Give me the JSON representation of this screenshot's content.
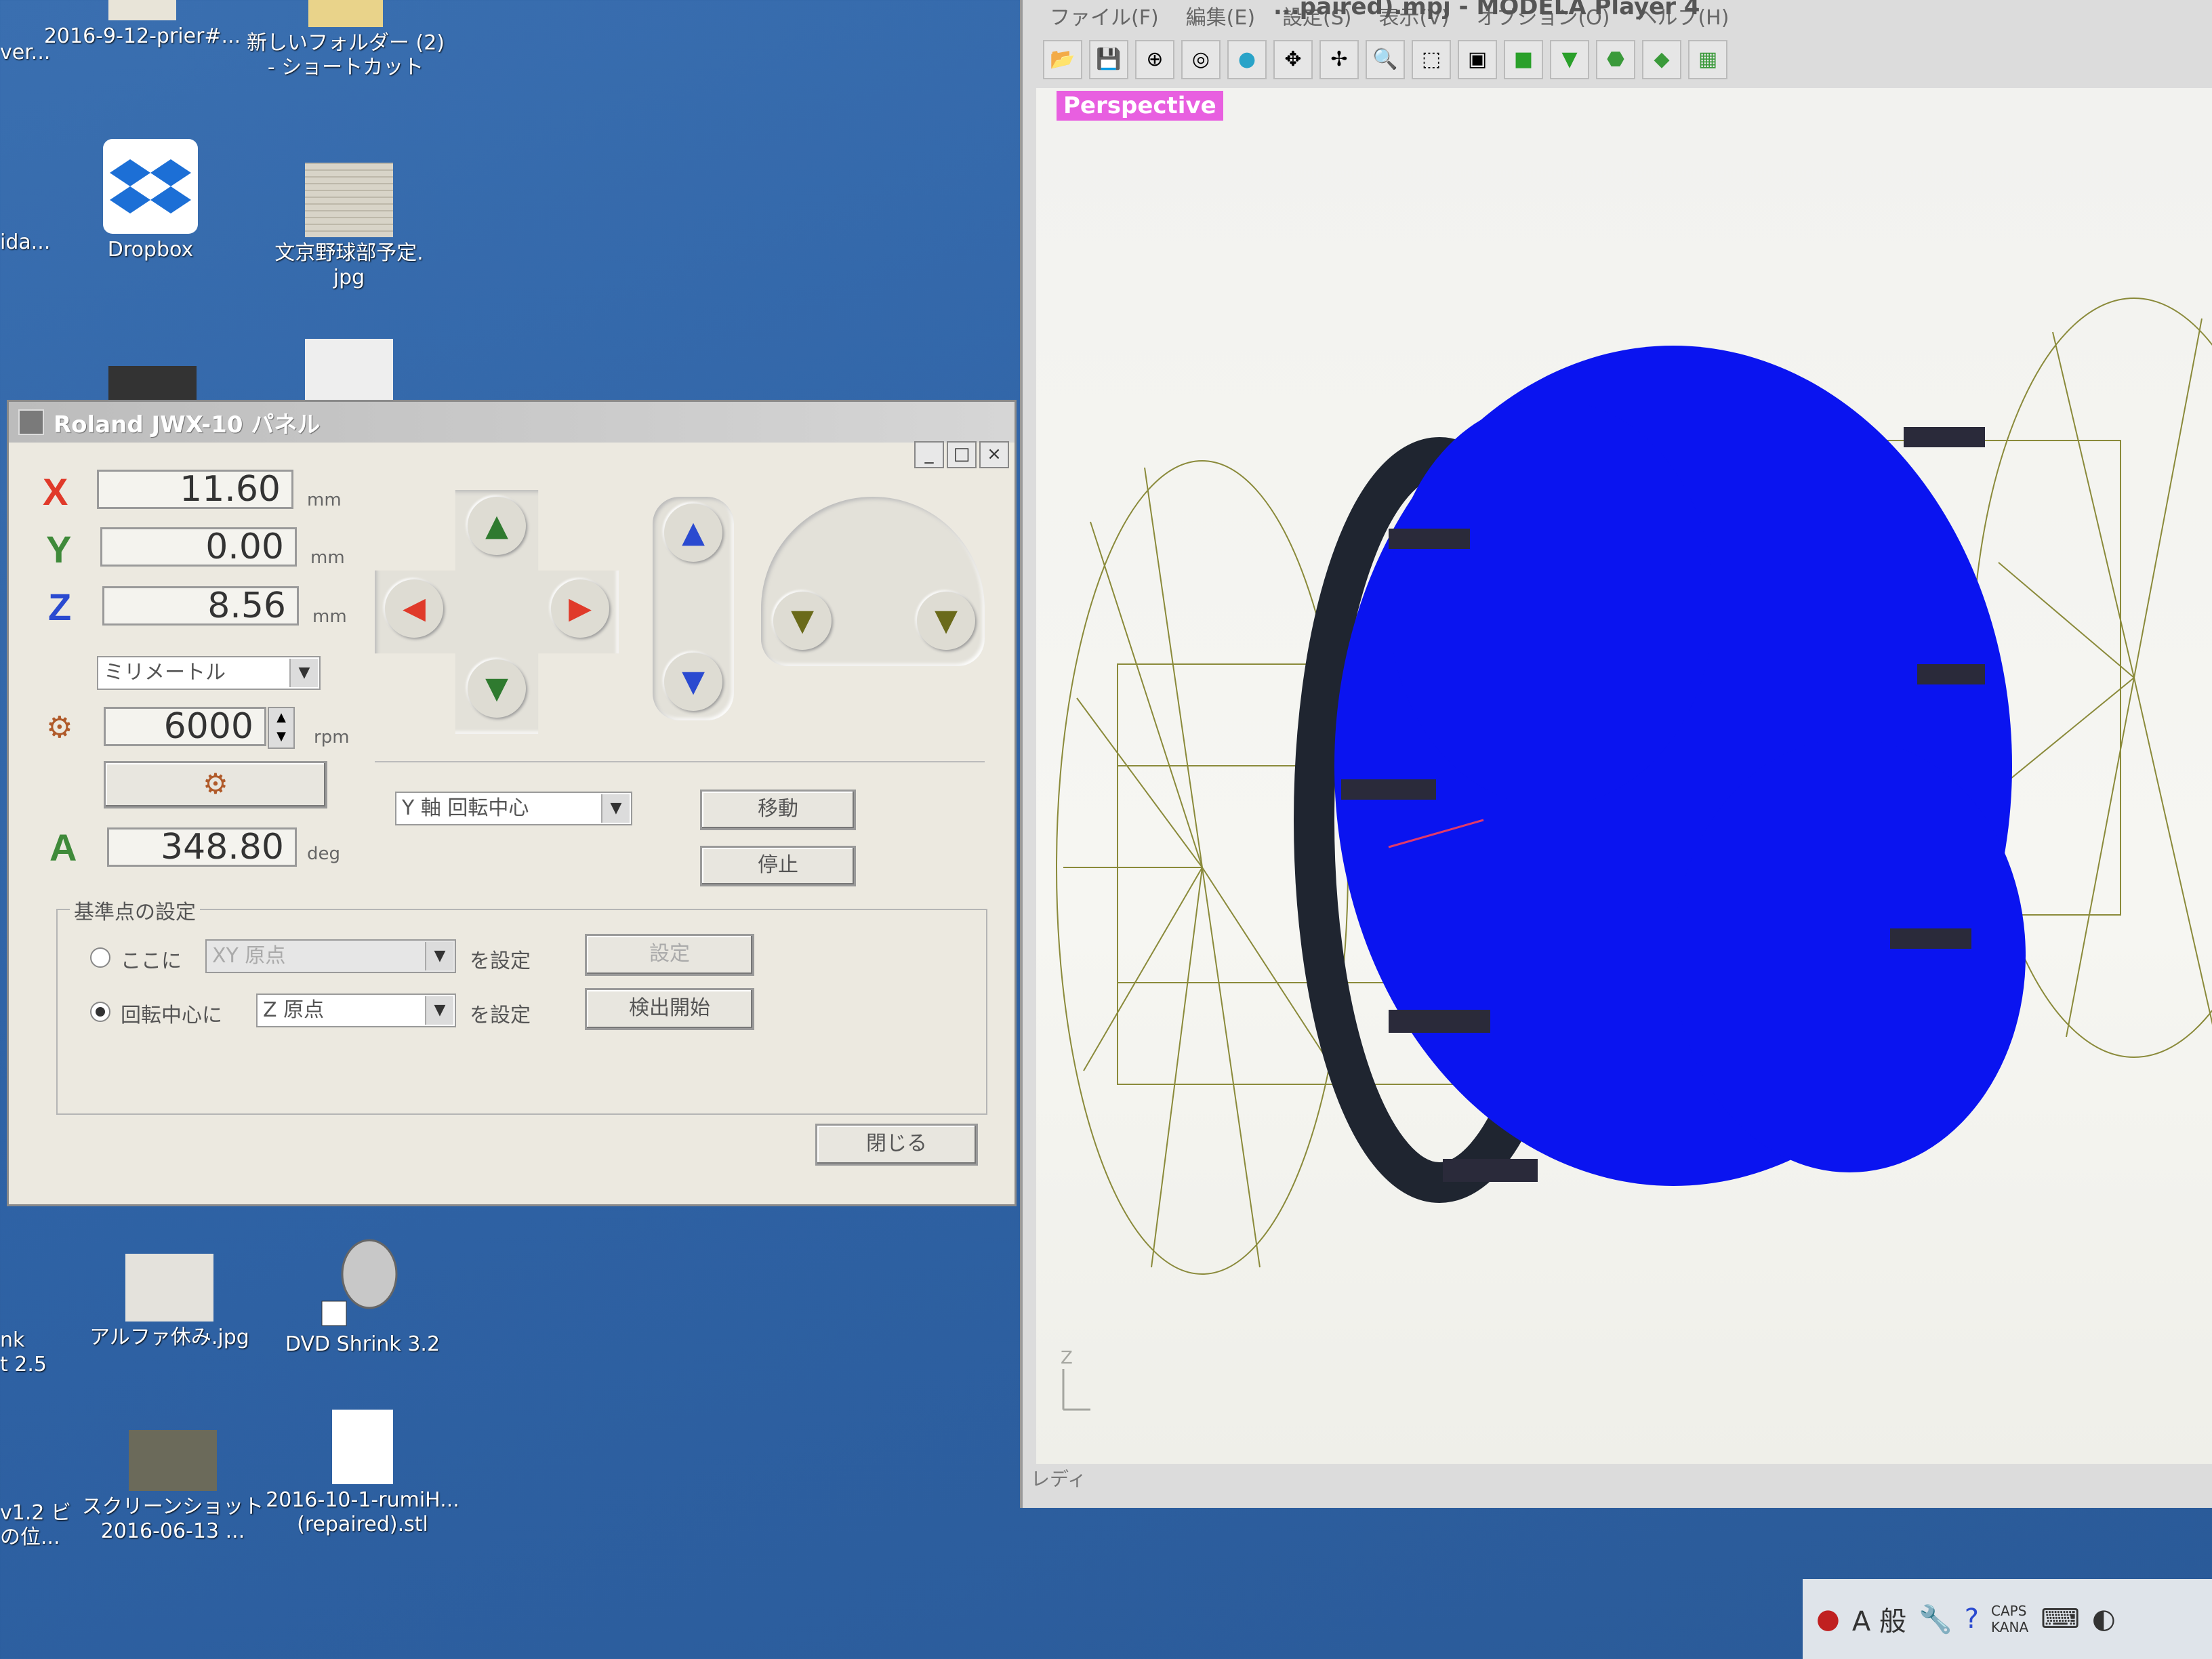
{
  "desktop": {
    "icons": [
      {
        "id": "prier",
        "label": "2016-9-12-prier#..."
      },
      {
        "id": "newfolder",
        "label": "新しいフォルダー (2)\n- ショートカット"
      },
      {
        "id": "dropbox",
        "label": "Dropbox"
      },
      {
        "id": "bunkyo",
        "label": "文京野球部予定.\njpg"
      },
      {
        "id": "alpha",
        "label": "アルファ休み.jpg"
      },
      {
        "id": "dvdshrink",
        "label": "DVD Shrink 3.2"
      },
      {
        "id": "screenshot",
        "label": "スクリーンショット\n2016-06-13 ..."
      },
      {
        "id": "stl",
        "label": "2016-10-1-rumiH...\n(repaired).stl"
      }
    ],
    "edge_labels": [
      "ver...",
      "ida...",
      "nk\nt 2.5",
      "v1.2 ビ\nの位..."
    ]
  },
  "panel": {
    "title": "Roland JWX-10 パネル",
    "x_label": "X",
    "x_value": "11.60",
    "x_unit": "mm",
    "y_label": "Y",
    "y_value": "0.00",
    "y_unit": "mm",
    "z_label": "Z",
    "z_value": "8.56",
    "z_unit": "mm",
    "unit_select": "ミリメートル",
    "spindle_value": "6000",
    "spindle_unit": "rpm",
    "a_label": "A",
    "a_value": "348.80",
    "a_unit": "deg",
    "rotation_select": "Y 軸 回転中心",
    "move_button": "移動",
    "stop_button": "停止",
    "group_title": "基準点の設定",
    "radio1_label": "ここに",
    "radio1_select": "XY 原点",
    "radio1_suffix": "を設定",
    "set_button": "設定",
    "radio2_label": "回転中心に",
    "radio2_select": "Z 原点",
    "radio2_suffix": "を設定",
    "detect_button": "検出開始",
    "close_button": "閉じる",
    "colors": {
      "x": "#e03a2a",
      "y": "#3f8a3a",
      "z": "#2a4ad0",
      "a": "#3f8a3a",
      "spindle": "#b05a2a"
    }
  },
  "modela": {
    "title": "...paired).mpj - MODELA Player 4",
    "menu": [
      "ファイル(F)",
      "編集(E)",
      "設定(S)",
      "表示(V)",
      "オプション(O)",
      "ヘルプ(H)"
    ],
    "view_label": "Perspective",
    "status": "レディ",
    "axis_z": "Z"
  },
  "tray": {
    "ime": "A 般",
    "caps": "CAPS\nKANA"
  }
}
